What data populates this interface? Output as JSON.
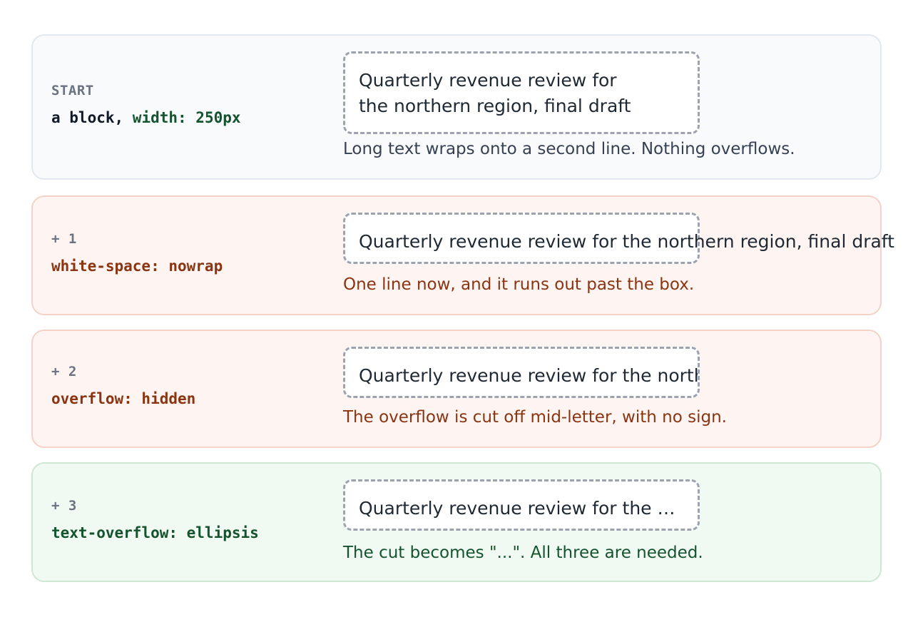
{
  "cards": [
    {
      "step": "START",
      "code_a": "a block, ",
      "code_b": "width: 250px",
      "demo_text": "Quarterly revenue review for the northern region, final draft",
      "note": "Long text wraps onto a second line. Nothing overflows."
    },
    {
      "step": "+ 1",
      "code": "white-space: nowrap",
      "demo_text": "Quarterly revenue review for the northern region, final draft",
      "note": "One line now, and it runs out past the box."
    },
    {
      "step": "+ 2",
      "code": "overflow: hidden",
      "demo_text": "Quarterly revenue review for the northern region, final draft",
      "note": "The overflow is cut off mid-letter, with no sign."
    },
    {
      "step": "+ 3",
      "code": "text-overflow: ellipsis",
      "demo_text": "Quarterly revenue review for the northern region, final draft",
      "note": "The cut becomes \"...\". All three are needed."
    }
  ],
  "colors": {
    "neutral_bg": "#f8fafc",
    "bad_bg": "#fef5f2",
    "good_bg": "#f0faf3",
    "rust_text": "#8a3412",
    "green_text": "#14532d"
  }
}
